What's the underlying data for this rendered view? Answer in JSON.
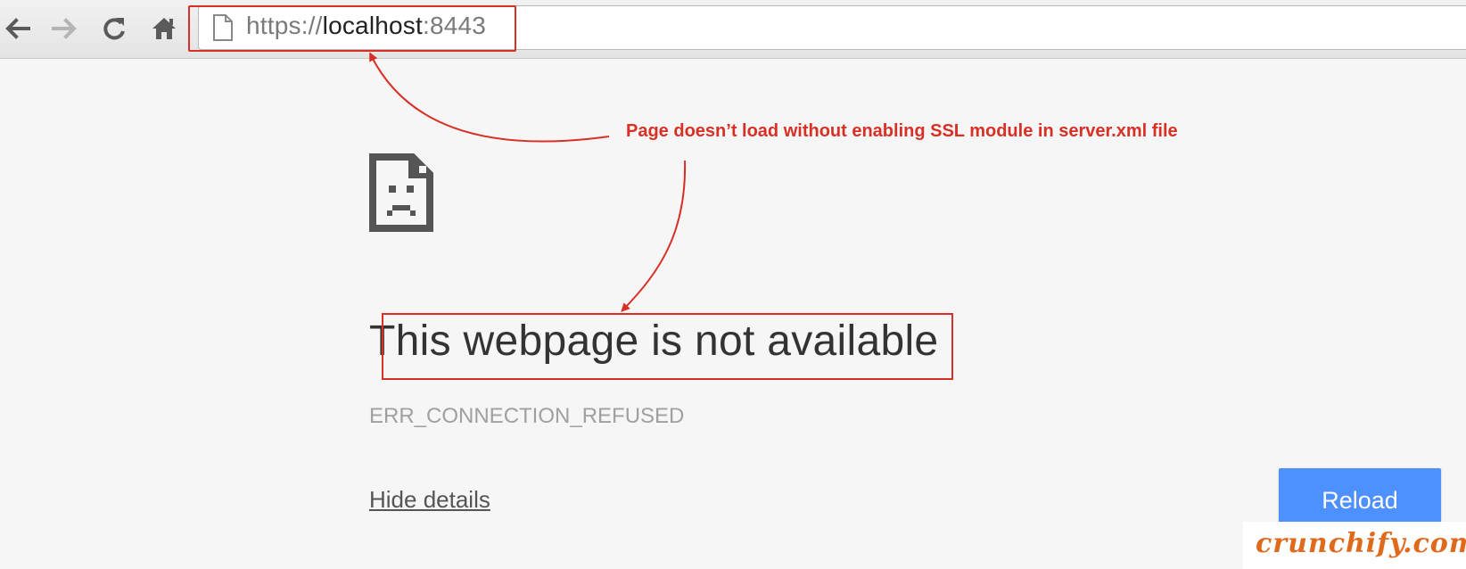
{
  "browser": {
    "url_scheme": "https://",
    "url_host": "localhost",
    "url_port": ":8443",
    "back_icon": "back-arrow-icon",
    "forward_icon": "forward-arrow-icon",
    "reload_icon": "reload-icon",
    "home_icon": "home-icon",
    "page_icon": "page-document-icon"
  },
  "error_page": {
    "icon": "sad-page-icon",
    "title": "This webpage is not available",
    "error_code": "ERR_CONNECTION_REFUSED",
    "details_link": "Hide details",
    "reload_button": "Reload"
  },
  "annotation": {
    "text": "Page doesn’t load without enabling SSL module in server.xml file",
    "color": "#d93025"
  },
  "watermark": {
    "text": "crunchify.com"
  },
  "colors": {
    "reload_button": "#4d90fe",
    "highlight": "#d93025",
    "background": "#f6f6f6"
  }
}
